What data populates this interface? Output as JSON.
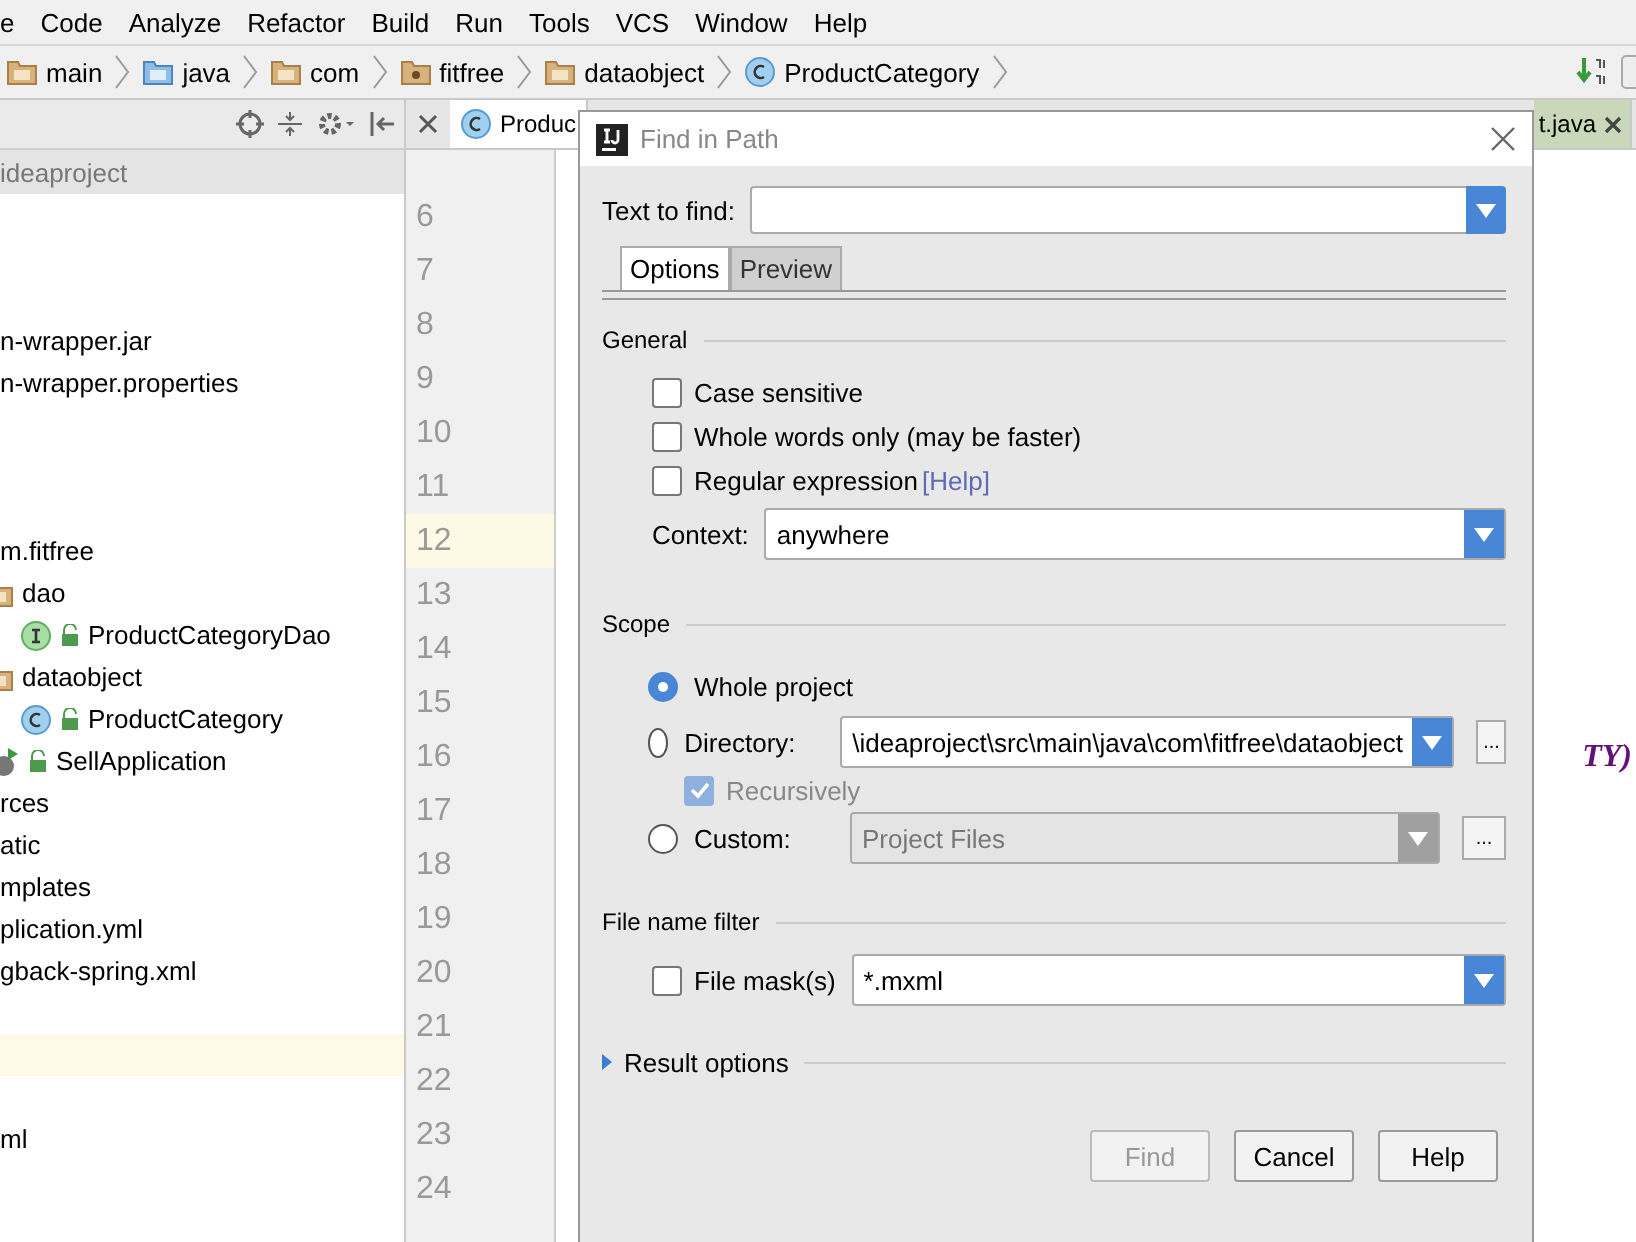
{
  "menu": [
    "e",
    "Code",
    "Analyze",
    "Refactor",
    "Build",
    "Run",
    "Tools",
    "VCS",
    "Window",
    "Help"
  ],
  "breadcrumbs": [
    {
      "label": "main",
      "kind": "folder"
    },
    {
      "label": "java",
      "kind": "source"
    },
    {
      "label": "com",
      "kind": "folder"
    },
    {
      "label": "fitfree",
      "kind": "package"
    },
    {
      "label": "dataobject",
      "kind": "folder"
    },
    {
      "label": "ProductCategory",
      "kind": "class"
    }
  ],
  "project_panel": {
    "header": "ideaproject",
    "rows": [
      {
        "kind": "clipped"
      },
      {
        "kind": "clipped"
      },
      {
        "kind": "clipped"
      },
      {
        "kind": "file",
        "label": "n-wrapper.jar"
      },
      {
        "kind": "file",
        "label": "n-wrapper.properties"
      },
      {
        "kind": "clipped"
      },
      {
        "kind": "clipped"
      },
      {
        "kind": "clipped"
      },
      {
        "kind": "file",
        "label": "m.fitfree"
      },
      {
        "kind": "folder",
        "label": "dao",
        "children": [
          {
            "kind": "interface",
            "label": "ProductCategoryDao"
          }
        ]
      },
      {
        "kind": "folder",
        "label": "dataobject",
        "children": [
          {
            "kind": "class",
            "label": "ProductCategory"
          }
        ]
      },
      {
        "kind": "app",
        "label": "SellApplication"
      },
      {
        "kind": "file",
        "label": "rces"
      },
      {
        "kind": "file",
        "label": "atic"
      },
      {
        "kind": "file",
        "label": "mplates"
      },
      {
        "kind": "file",
        "label": "plication.yml"
      },
      {
        "kind": "file",
        "label": "gback-spring.xml"
      },
      {
        "kind": "clipped"
      },
      {
        "kind": "clipped",
        "selected": true
      },
      {
        "kind": "clipped"
      },
      {
        "kind": "file",
        "label": "ml"
      }
    ]
  },
  "editor_tabs": [
    {
      "label": "Produc",
      "selected": true
    },
    {
      "label": "t.java",
      "selected": false
    }
  ],
  "gutter": {
    "lines": [
      {
        "n": "6",
        "current": false
      },
      {
        "n": "7",
        "current": false
      },
      {
        "n": "8",
        "current": false
      },
      {
        "n": "9",
        "current": false
      },
      {
        "n": "10",
        "current": false
      },
      {
        "n": "11",
        "current": false
      },
      {
        "n": "12",
        "current": true
      },
      {
        "n": "13",
        "current": false
      },
      {
        "n": "14",
        "current": false
      },
      {
        "n": "15",
        "current": false
      },
      {
        "n": "16",
        "current": false
      },
      {
        "n": "17",
        "current": false
      },
      {
        "n": "18",
        "current": false
      },
      {
        "n": "19",
        "current": false
      },
      {
        "n": "20",
        "current": false
      },
      {
        "n": "21",
        "current": false
      },
      {
        "n": "22",
        "current": false
      },
      {
        "n": "23",
        "current": false
      },
      {
        "n": "24",
        "current": false
      }
    ]
  },
  "code_fragment": "TY)",
  "dialog": {
    "title": "Find in Path",
    "text_to_find": {
      "label": "Text to find:"
    },
    "tabs": [
      {
        "label": "Options",
        "selected": true
      },
      {
        "label": "Preview",
        "selected": false
      }
    ],
    "general": {
      "title": "General",
      "options": [
        {
          "label": "Case sensitive",
          "checked": false
        },
        {
          "label": "Whole words only (may be faster)",
          "checked": false
        },
        {
          "label": "Regular expression",
          "checked": false,
          "link": "[Help]"
        }
      ],
      "context": {
        "label": "Context:",
        "value": "anywhere"
      }
    },
    "scope": {
      "title": "Scope",
      "choices": [
        {
          "kind": "plain",
          "label": "Whole project",
          "selected": true
        },
        {
          "kind": "directory",
          "label": "Directory:",
          "selected": false,
          "value": "\\ideaproject\\src\\main\\java\\com\\fitfree\\dataobject",
          "browse": "...",
          "recursive": {
            "label": "Recursively",
            "checked": true,
            "disabled": true
          }
        },
        {
          "kind": "custom",
          "label": "Custom:",
          "selected": false,
          "value": "Project Files",
          "browse": "..."
        }
      ]
    },
    "file_filter": {
      "title": "File name filter",
      "mask": {
        "label": "File mask(s)",
        "checked": false,
        "value": "*.mxml"
      }
    },
    "result_options": {
      "label": "Result options",
      "expanded": false
    },
    "buttons": [
      {
        "label": "Find",
        "disabled": true
      },
      {
        "label": "Cancel",
        "disabled": false
      },
      {
        "label": "Help",
        "disabled": false
      }
    ]
  }
}
